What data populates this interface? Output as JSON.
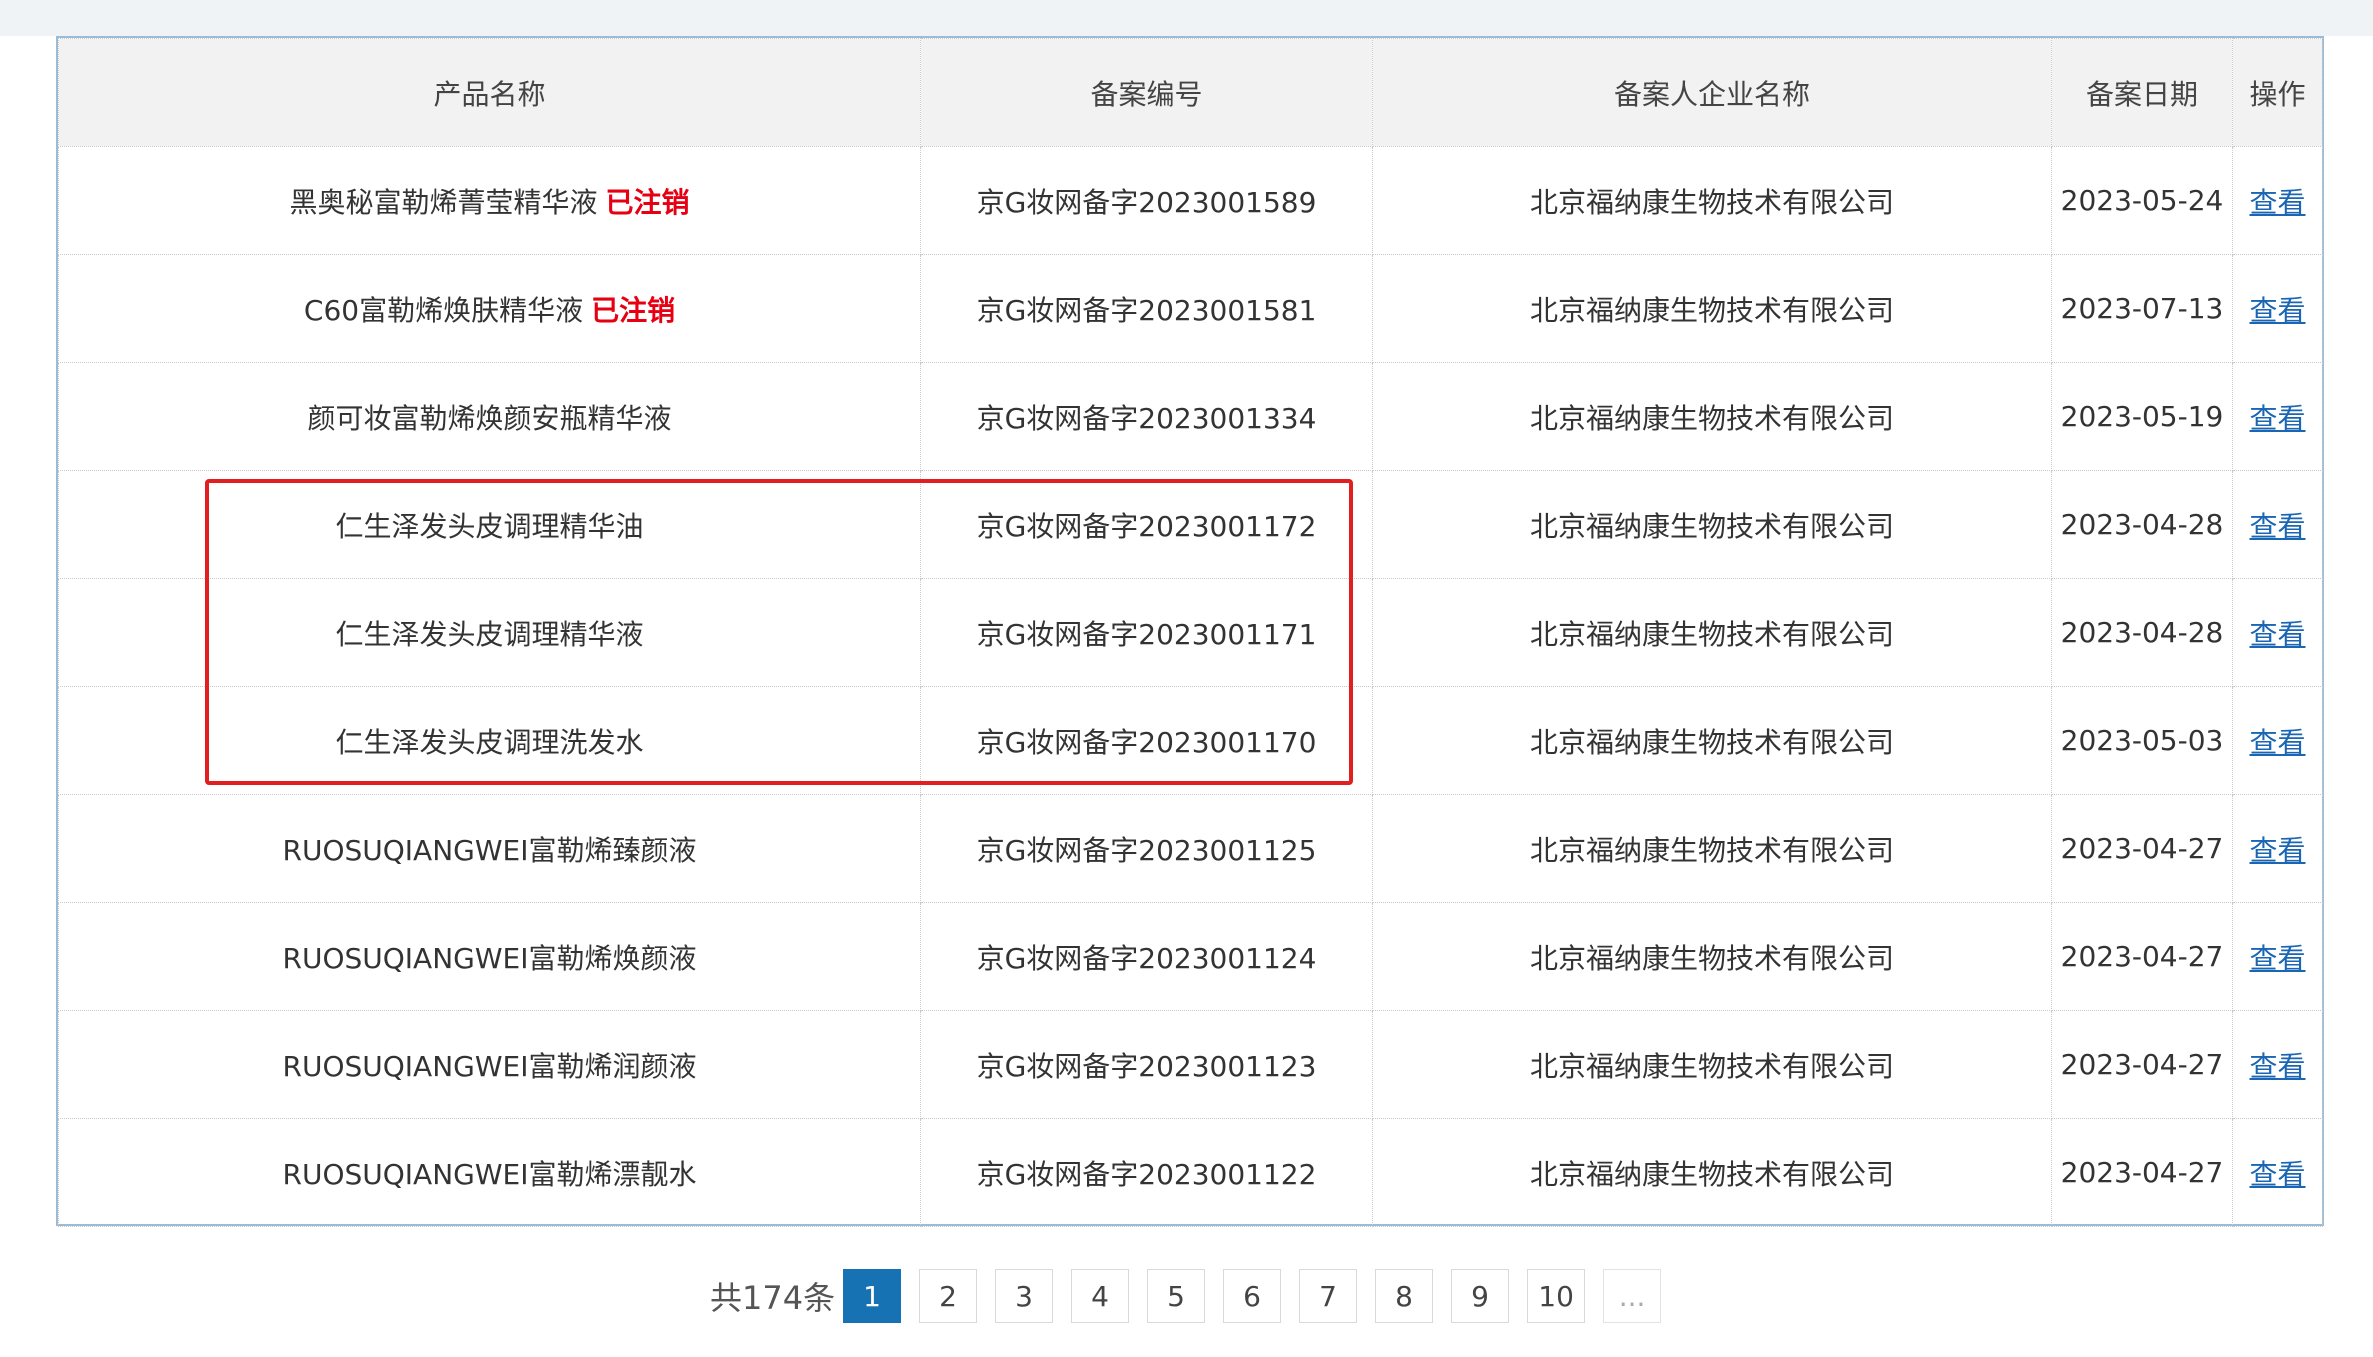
{
  "table": {
    "headers": [
      "产品名称",
      "备案编号",
      "备案人企业名称",
      "备案日期",
      "操作"
    ],
    "rows": [
      {
        "name": "黑奥秘富勒烯菁莹精华液",
        "status": "已注销",
        "code": "京G妆网备字2023001589",
        "company": "北京福纳康生物技术有限公司",
        "date": "2023-05-24",
        "action": "查看"
      },
      {
        "name": "C60富勒烯焕肤精华液",
        "status": "已注销",
        "code": "京G妆网备字2023001581",
        "company": "北京福纳康生物技术有限公司",
        "date": "2023-07-13",
        "action": "查看"
      },
      {
        "name": "颜可妆富勒烯焕颜安瓶精华液",
        "status": "",
        "code": "京G妆网备字2023001334",
        "company": "北京福纳康生物技术有限公司",
        "date": "2023-05-19",
        "action": "查看"
      },
      {
        "name": "仁生泽发头皮调理精华油",
        "status": "",
        "code": "京G妆网备字2023001172",
        "company": "北京福纳康生物技术有限公司",
        "date": "2023-04-28",
        "action": "查看"
      },
      {
        "name": "仁生泽发头皮调理精华液",
        "status": "",
        "code": "京G妆网备字2023001171",
        "company": "北京福纳康生物技术有限公司",
        "date": "2023-04-28",
        "action": "查看"
      },
      {
        "name": "仁生泽发头皮调理洗发水",
        "status": "",
        "code": "京G妆网备字2023001170",
        "company": "北京福纳康生物技术有限公司",
        "date": "2023-05-03",
        "action": "查看"
      },
      {
        "name": "RUOSUQIANGWEI富勒烯臻颜液",
        "status": "",
        "code": "京G妆网备字2023001125",
        "company": "北京福纳康生物技术有限公司",
        "date": "2023-04-27",
        "action": "查看"
      },
      {
        "name": "RUOSUQIANGWEI富勒烯焕颜液",
        "status": "",
        "code": "京G妆网备字2023001124",
        "company": "北京福纳康生物技术有限公司",
        "date": "2023-04-27",
        "action": "查看"
      },
      {
        "name": "RUOSUQIANGWEI富勒烯润颜液",
        "status": "",
        "code": "京G妆网备字2023001123",
        "company": "北京福纳康生物技术有限公司",
        "date": "2023-04-27",
        "action": "查看"
      },
      {
        "name": "RUOSUQIANGWEI富勒烯漂靓水",
        "status": "",
        "code": "京G妆网备字2023001122",
        "company": "北京福纳康生物技术有限公司",
        "date": "2023-04-27",
        "action": "查看"
      }
    ]
  },
  "pagination": {
    "total_label": "共174条",
    "pages": [
      "1",
      "2",
      "3",
      "4",
      "5",
      "6",
      "7",
      "8",
      "9",
      "10",
      "..."
    ],
    "current": "1"
  },
  "colors": {
    "cancelled": "#e60012",
    "link": "#1a66b3",
    "highlight_border": "#e02020",
    "active_page": "#1772b4"
  }
}
